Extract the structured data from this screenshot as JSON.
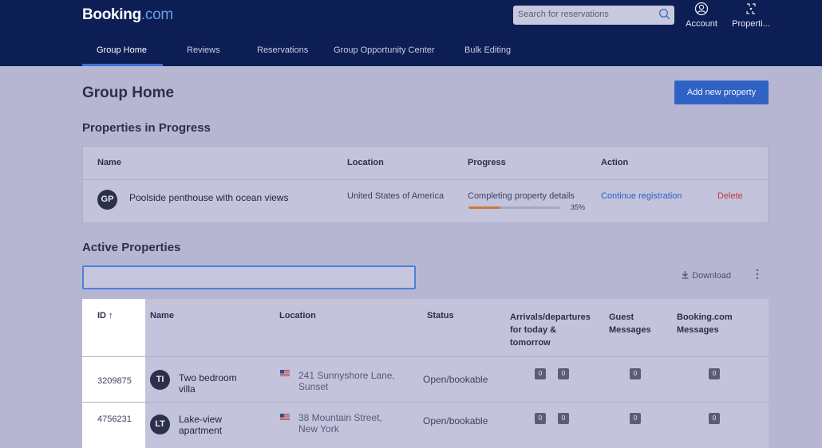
{
  "header": {
    "logo_main": "Booking",
    "logo_suffix": ".com",
    "search_placeholder": "Search for reservations",
    "account_label": "Account",
    "properties_label": "Properti..."
  },
  "tabs": [
    {
      "label": "Group Home",
      "active": true
    },
    {
      "label": "Reviews"
    },
    {
      "label": "Reservations"
    },
    {
      "label": "Group Opportunity Center"
    },
    {
      "label": "Bulk Editing"
    }
  ],
  "page": {
    "title": "Group Home",
    "add_button": "Add new property"
  },
  "in_progress": {
    "title": "Properties in Progress",
    "columns": {
      "name": "Name",
      "location": "Location",
      "progress": "Progress",
      "action": "Action"
    },
    "rows": [
      {
        "initials": "GP",
        "name": "Poolside penthouse with ocean views",
        "location": "United States of America",
        "progress_label": "Completing property details",
        "progress_percent": 35,
        "progress_text": "35%",
        "continue_label": "Continue registration",
        "delete_label": "Delete"
      }
    ]
  },
  "active": {
    "title": "Active Properties",
    "filter_value": "",
    "download_label": "Download",
    "columns": {
      "id": "ID ↑",
      "name": "Name",
      "location": "Location",
      "status": "Status",
      "arrivals_1": "Arrivals/departures",
      "arrivals_2": "for today &",
      "arrivals_3": "tomorrow",
      "guest_1": "Guest",
      "guest_2": "Messages",
      "booking_1": "Booking.com",
      "booking_2": "Messages"
    },
    "rows": [
      {
        "id": "3209875",
        "initials": "TI",
        "name_1": "Two bedroom",
        "name_2": "villa",
        "loc_1": "241 Sunnyshore Lane,",
        "loc_2": "Sunset",
        "status": "Open/bookable",
        "arrivals": "0",
        "departures": "0",
        "guest_messages": "0",
        "booking_messages": "0"
      },
      {
        "id": "4756231",
        "initials": "LT",
        "name_1": "Lake-view",
        "name_2": "apartment",
        "loc_1": "38 Mountain Street,",
        "loc_2": "New York",
        "status": "Open/bookable",
        "arrivals": "0",
        "departures": "0",
        "guest_messages": "0",
        "booking_messages": "0"
      }
    ]
  }
}
